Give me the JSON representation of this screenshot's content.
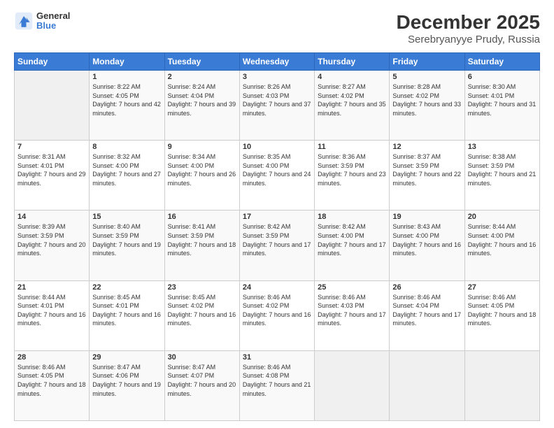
{
  "logo": {
    "text1": "General",
    "text2": "Blue"
  },
  "title": "December 2025",
  "subtitle": "Serebryanyye Prudy, Russia",
  "header_days": [
    "Sunday",
    "Monday",
    "Tuesday",
    "Wednesday",
    "Thursday",
    "Friday",
    "Saturday"
  ],
  "weeks": [
    [
      {
        "day": "",
        "sunrise": "",
        "sunset": "",
        "daylight": ""
      },
      {
        "day": "1",
        "sunrise": "Sunrise: 8:22 AM",
        "sunset": "Sunset: 4:05 PM",
        "daylight": "Daylight: 7 hours and 42 minutes."
      },
      {
        "day": "2",
        "sunrise": "Sunrise: 8:24 AM",
        "sunset": "Sunset: 4:04 PM",
        "daylight": "Daylight: 7 hours and 39 minutes."
      },
      {
        "day": "3",
        "sunrise": "Sunrise: 8:26 AM",
        "sunset": "Sunset: 4:03 PM",
        "daylight": "Daylight: 7 hours and 37 minutes."
      },
      {
        "day": "4",
        "sunrise": "Sunrise: 8:27 AM",
        "sunset": "Sunset: 4:02 PM",
        "daylight": "Daylight: 7 hours and 35 minutes."
      },
      {
        "day": "5",
        "sunrise": "Sunrise: 8:28 AM",
        "sunset": "Sunset: 4:02 PM",
        "daylight": "Daylight: 7 hours and 33 minutes."
      },
      {
        "day": "6",
        "sunrise": "Sunrise: 8:30 AM",
        "sunset": "Sunset: 4:01 PM",
        "daylight": "Daylight: 7 hours and 31 minutes."
      }
    ],
    [
      {
        "day": "7",
        "sunrise": "Sunrise: 8:31 AM",
        "sunset": "Sunset: 4:01 PM",
        "daylight": "Daylight: 7 hours and 29 minutes."
      },
      {
        "day": "8",
        "sunrise": "Sunrise: 8:32 AM",
        "sunset": "Sunset: 4:00 PM",
        "daylight": "Daylight: 7 hours and 27 minutes."
      },
      {
        "day": "9",
        "sunrise": "Sunrise: 8:34 AM",
        "sunset": "Sunset: 4:00 PM",
        "daylight": "Daylight: 7 hours and 26 minutes."
      },
      {
        "day": "10",
        "sunrise": "Sunrise: 8:35 AM",
        "sunset": "Sunset: 4:00 PM",
        "daylight": "Daylight: 7 hours and 24 minutes."
      },
      {
        "day": "11",
        "sunrise": "Sunrise: 8:36 AM",
        "sunset": "Sunset: 3:59 PM",
        "daylight": "Daylight: 7 hours and 23 minutes."
      },
      {
        "day": "12",
        "sunrise": "Sunrise: 8:37 AM",
        "sunset": "Sunset: 3:59 PM",
        "daylight": "Daylight: 7 hours and 22 minutes."
      },
      {
        "day": "13",
        "sunrise": "Sunrise: 8:38 AM",
        "sunset": "Sunset: 3:59 PM",
        "daylight": "Daylight: 7 hours and 21 minutes."
      }
    ],
    [
      {
        "day": "14",
        "sunrise": "Sunrise: 8:39 AM",
        "sunset": "Sunset: 3:59 PM",
        "daylight": "Daylight: 7 hours and 20 minutes."
      },
      {
        "day": "15",
        "sunrise": "Sunrise: 8:40 AM",
        "sunset": "Sunset: 3:59 PM",
        "daylight": "Daylight: 7 hours and 19 minutes."
      },
      {
        "day": "16",
        "sunrise": "Sunrise: 8:41 AM",
        "sunset": "Sunset: 3:59 PM",
        "daylight": "Daylight: 7 hours and 18 minutes."
      },
      {
        "day": "17",
        "sunrise": "Sunrise: 8:42 AM",
        "sunset": "Sunset: 3:59 PM",
        "daylight": "Daylight: 7 hours and 17 minutes."
      },
      {
        "day": "18",
        "sunrise": "Sunrise: 8:42 AM",
        "sunset": "Sunset: 4:00 PM",
        "daylight": "Daylight: 7 hours and 17 minutes."
      },
      {
        "day": "19",
        "sunrise": "Sunrise: 8:43 AM",
        "sunset": "Sunset: 4:00 PM",
        "daylight": "Daylight: 7 hours and 16 minutes."
      },
      {
        "day": "20",
        "sunrise": "Sunrise: 8:44 AM",
        "sunset": "Sunset: 4:00 PM",
        "daylight": "Daylight: 7 hours and 16 minutes."
      }
    ],
    [
      {
        "day": "21",
        "sunrise": "Sunrise: 8:44 AM",
        "sunset": "Sunset: 4:01 PM",
        "daylight": "Daylight: 7 hours and 16 minutes."
      },
      {
        "day": "22",
        "sunrise": "Sunrise: 8:45 AM",
        "sunset": "Sunset: 4:01 PM",
        "daylight": "Daylight: 7 hours and 16 minutes."
      },
      {
        "day": "23",
        "sunrise": "Sunrise: 8:45 AM",
        "sunset": "Sunset: 4:02 PM",
        "daylight": "Daylight: 7 hours and 16 minutes."
      },
      {
        "day": "24",
        "sunrise": "Sunrise: 8:46 AM",
        "sunset": "Sunset: 4:02 PM",
        "daylight": "Daylight: 7 hours and 16 minutes."
      },
      {
        "day": "25",
        "sunrise": "Sunrise: 8:46 AM",
        "sunset": "Sunset: 4:03 PM",
        "daylight": "Daylight: 7 hours and 17 minutes."
      },
      {
        "day": "26",
        "sunrise": "Sunrise: 8:46 AM",
        "sunset": "Sunset: 4:04 PM",
        "daylight": "Daylight: 7 hours and 17 minutes."
      },
      {
        "day": "27",
        "sunrise": "Sunrise: 8:46 AM",
        "sunset": "Sunset: 4:05 PM",
        "daylight": "Daylight: 7 hours and 18 minutes."
      }
    ],
    [
      {
        "day": "28",
        "sunrise": "Sunrise: 8:46 AM",
        "sunset": "Sunset: 4:05 PM",
        "daylight": "Daylight: 7 hours and 18 minutes."
      },
      {
        "day": "29",
        "sunrise": "Sunrise: 8:47 AM",
        "sunset": "Sunset: 4:06 PM",
        "daylight": "Daylight: 7 hours and 19 minutes."
      },
      {
        "day": "30",
        "sunrise": "Sunrise: 8:47 AM",
        "sunset": "Sunset: 4:07 PM",
        "daylight": "Daylight: 7 hours and 20 minutes."
      },
      {
        "day": "31",
        "sunrise": "Sunrise: 8:46 AM",
        "sunset": "Sunset: 4:08 PM",
        "daylight": "Daylight: 7 hours and 21 minutes."
      },
      {
        "day": "",
        "sunrise": "",
        "sunset": "",
        "daylight": ""
      },
      {
        "day": "",
        "sunrise": "",
        "sunset": "",
        "daylight": ""
      },
      {
        "day": "",
        "sunrise": "",
        "sunset": "",
        "daylight": ""
      }
    ]
  ]
}
